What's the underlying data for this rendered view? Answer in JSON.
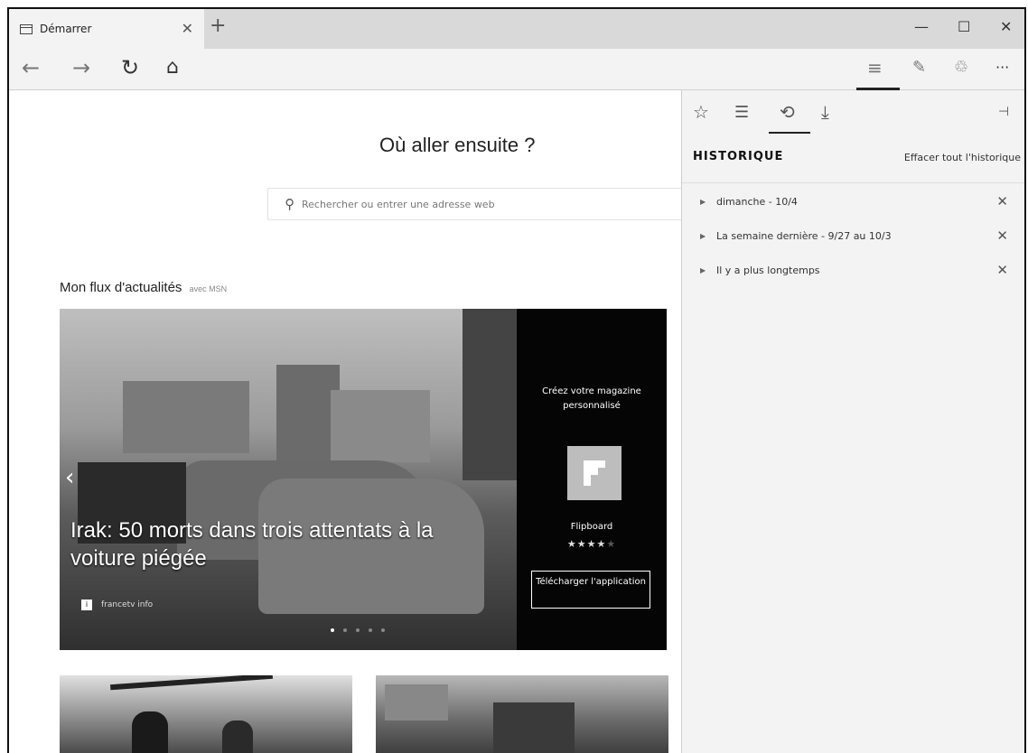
{
  "tab": {
    "title": "Démarrer",
    "close": "✕"
  },
  "newtab": "+",
  "window": {
    "minimize": "—",
    "maximize": "☐",
    "close": "✕"
  },
  "nav": {
    "back": "←",
    "forward": "→",
    "refresh": "↻",
    "home": "⌂",
    "hub": "≡",
    "note": "✎",
    "share": "♲",
    "more": "···"
  },
  "main": {
    "headline": "Où aller ensuite ?",
    "search_placeholder": "Rechercher ou entrer une adresse web",
    "feed_title": "Mon flux d'actualités",
    "feed_sub": "avec MSN",
    "hero_title": "Irak: 50 morts dans trois attentats à la voiture piégée",
    "hero_source": "francetv info",
    "ad_title": "Créez votre magazine personnalisé",
    "ad_name": "Flipboard",
    "ad_stars": "★★★★★",
    "ad_rating": 4,
    "ad_button": "Télécharger l'application",
    "carousel_count": 5,
    "carousel_active": 1
  },
  "hub": {
    "icons": {
      "favorites": "☆",
      "reading_list": "☰",
      "history": "⟲",
      "downloads": "⤓",
      "pin": "⊣"
    },
    "heading": "HISTORIQUE",
    "clear": "Effacer tout l'historique",
    "items": [
      {
        "label": "dimanche - 10/4"
      },
      {
        "label": "La semaine dernière - 9/27 au 10/3"
      },
      {
        "label": "Il y a plus longtemps"
      }
    ],
    "remove": "✕",
    "expand": "▶"
  }
}
